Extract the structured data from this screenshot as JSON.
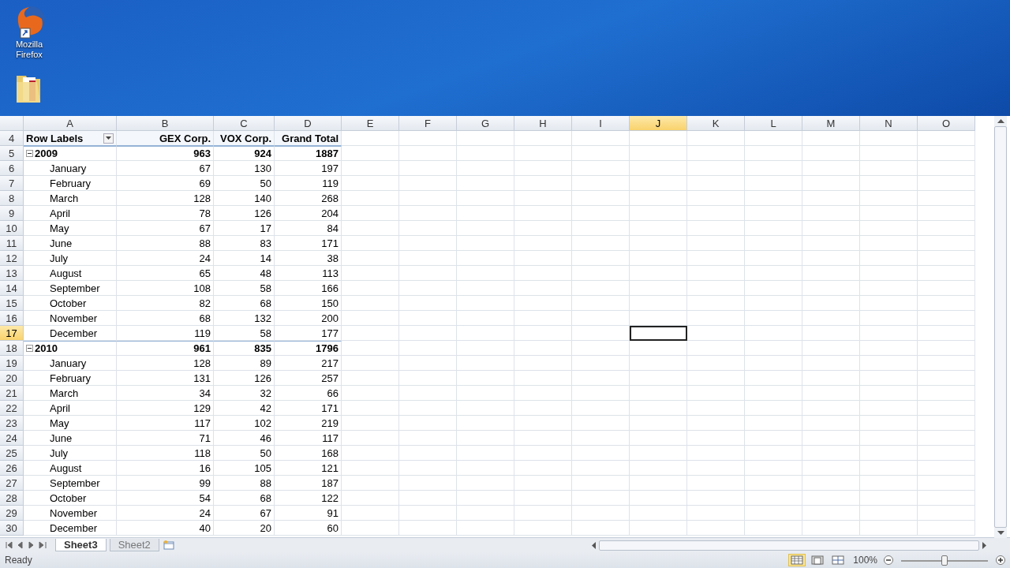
{
  "desktop": {
    "icons": [
      {
        "kind": "browser",
        "label": "Mozilla Firefox"
      },
      {
        "kind": "folder"
      }
    ]
  },
  "sheet": {
    "columns": [
      {
        "label": "A",
        "selected": false
      },
      {
        "label": "B",
        "selected": false
      },
      {
        "label": "C",
        "selected": false
      },
      {
        "label": "D",
        "selected": false
      },
      {
        "label": "E",
        "selected": false
      },
      {
        "label": "F",
        "selected": false
      },
      {
        "label": "G",
        "selected": false
      },
      {
        "label": "H",
        "selected": false
      },
      {
        "label": "I",
        "selected": false
      },
      {
        "label": "J",
        "selected": true
      },
      {
        "label": "K",
        "selected": false
      },
      {
        "label": "L",
        "selected": false
      },
      {
        "label": "M",
        "selected": false
      },
      {
        "label": "N",
        "selected": false
      },
      {
        "label": "O",
        "selected": false
      }
    ],
    "header": {
      "number": "4",
      "cells": [
        "Row Labels",
        "GEX Corp.",
        "VOX Corp.",
        "Grand Total"
      ]
    },
    "rows": [
      {
        "number": "5",
        "kind": "year",
        "label": "2009",
        "expanded": true,
        "values": [
          "963",
          "924",
          "1887"
        ],
        "selected": false
      },
      {
        "number": "6",
        "kind": "month",
        "label": "January",
        "values": [
          "67",
          "130",
          "197"
        ],
        "selected": false
      },
      {
        "number": "7",
        "kind": "month",
        "label": "February",
        "values": [
          "69",
          "50",
          "119"
        ],
        "selected": false
      },
      {
        "number": "8",
        "kind": "month",
        "label": "March",
        "values": [
          "128",
          "140",
          "268"
        ],
        "selected": false
      },
      {
        "number": "9",
        "kind": "month",
        "label": "April",
        "values": [
          "78",
          "126",
          "204"
        ],
        "selected": false
      },
      {
        "number": "10",
        "kind": "month",
        "label": "May",
        "values": [
          "67",
          "17",
          "84"
        ],
        "selected": false
      },
      {
        "number": "11",
        "kind": "month",
        "label": "June",
        "values": [
          "88",
          "83",
          "171"
        ],
        "selected": false
      },
      {
        "number": "12",
        "kind": "month",
        "label": "July",
        "values": [
          "24",
          "14",
          "38"
        ],
        "selected": false
      },
      {
        "number": "13",
        "kind": "month",
        "label": "August",
        "values": [
          "65",
          "48",
          "113"
        ],
        "selected": false
      },
      {
        "number": "14",
        "kind": "month",
        "label": "September",
        "values": [
          "108",
          "58",
          "166"
        ],
        "selected": false
      },
      {
        "number": "15",
        "kind": "month",
        "label": "October",
        "values": [
          "82",
          "68",
          "150"
        ],
        "selected": false
      },
      {
        "number": "16",
        "kind": "month",
        "label": "November",
        "values": [
          "68",
          "132",
          "200"
        ],
        "selected": false
      },
      {
        "number": "17",
        "kind": "month",
        "label": "December",
        "values": [
          "119",
          "58",
          "177"
        ],
        "selected": true
      },
      {
        "number": "18",
        "kind": "year",
        "label": "2010",
        "expanded": true,
        "values": [
          "961",
          "835",
          "1796"
        ],
        "selected": false
      },
      {
        "number": "19",
        "kind": "month",
        "label": "January",
        "values": [
          "128",
          "89",
          "217"
        ],
        "selected": false
      },
      {
        "number": "20",
        "kind": "month",
        "label": "February",
        "values": [
          "131",
          "126",
          "257"
        ],
        "selected": false
      },
      {
        "number": "21",
        "kind": "month",
        "label": "March",
        "values": [
          "34",
          "32",
          "66"
        ],
        "selected": false
      },
      {
        "number": "22",
        "kind": "month",
        "label": "April",
        "values": [
          "129",
          "42",
          "171"
        ],
        "selected": false
      },
      {
        "number": "23",
        "kind": "month",
        "label": "May",
        "values": [
          "117",
          "102",
          "219"
        ],
        "selected": false
      },
      {
        "number": "24",
        "kind": "month",
        "label": "June",
        "values": [
          "71",
          "46",
          "117"
        ],
        "selected": false
      },
      {
        "number": "25",
        "kind": "month",
        "label": "July",
        "values": [
          "118",
          "50",
          "168"
        ],
        "selected": false
      },
      {
        "number": "26",
        "kind": "month",
        "label": "August",
        "values": [
          "16",
          "105",
          "121"
        ],
        "selected": false
      },
      {
        "number": "27",
        "kind": "month",
        "label": "September",
        "values": [
          "99",
          "88",
          "187"
        ],
        "selected": false
      },
      {
        "number": "28",
        "kind": "month",
        "label": "October",
        "values": [
          "54",
          "68",
          "122"
        ],
        "selected": false
      },
      {
        "number": "29",
        "kind": "month",
        "label": "November",
        "values": [
          "24",
          "67",
          "91"
        ],
        "selected": false
      },
      {
        "number": "30",
        "kind": "month",
        "label": "December",
        "values": [
          "40",
          "20",
          "60"
        ],
        "selected": false
      }
    ]
  },
  "sheet_tabs": [
    {
      "label": "Sheet3",
      "selected": true
    },
    {
      "label": "Sheet2",
      "selected": false
    }
  ],
  "status_bar": {
    "status": "Ready",
    "views": [
      {
        "kind": "normal",
        "selected": true
      },
      {
        "kind": "layout",
        "selected": false
      },
      {
        "kind": "break",
        "selected": false
      }
    ],
    "zoom": "100%",
    "zoom_slider": {
      "level": 0.5
    }
  }
}
